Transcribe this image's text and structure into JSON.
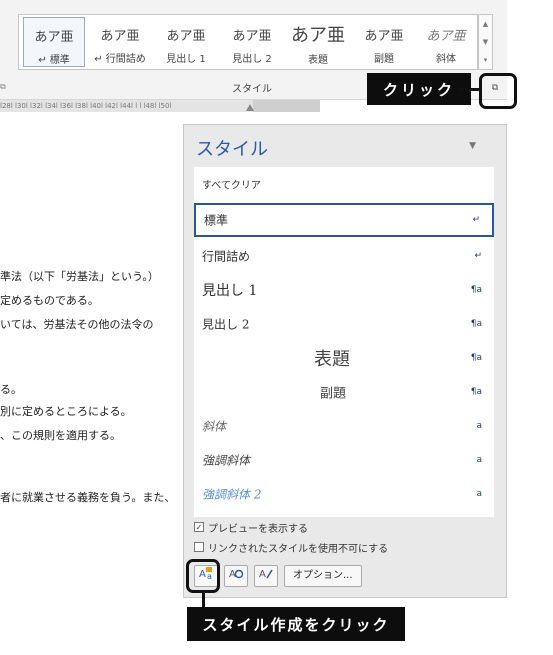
{
  "ribbon": {
    "gallery_items": [
      {
        "sample": "あア亜",
        "label": "↵ 標準"
      },
      {
        "sample": "あア亜",
        "label": "↵ 行間詰め"
      },
      {
        "sample": "あア亜",
        "label": "見出し 1"
      },
      {
        "sample": "あア亜",
        "label": "見出し 2"
      },
      {
        "sample": "あア亜",
        "label": "表題"
      },
      {
        "sample": "あア亜",
        "label": "副題"
      },
      {
        "sample": "あア亜",
        "label": "斜体"
      }
    ],
    "group_label": "スタイル",
    "launcher_icon": "dialog-launcher-icon"
  },
  "callouts": {
    "top": "クリック",
    "bottom": "スタイル作成をクリック"
  },
  "ruler": {
    "ticks": "l28l  l30l  l32l  l34l  l36l  l38l  l40l  l42l  l44l  l  l  l48l  l50l"
  },
  "document": {
    "lines": [
      "準法（以下「労基法」という。）",
      "定めるものである。",
      "いては、労基法その他の法令の",
      "る。",
      "別に定めるところによる。",
      "、この規則を適用する。",
      "者に就業させる義務を負う。また、"
    ]
  },
  "styles_pane": {
    "title": "スタイル",
    "dropdown_icon": "▼",
    "items": [
      {
        "name": "すべてクリア",
        "mark": ""
      },
      {
        "name": "標準",
        "mark": "↵"
      },
      {
        "name": "行間詰め",
        "mark": "↵"
      },
      {
        "name": "見出し 1",
        "mark": "¶a"
      },
      {
        "name": "見出し 2",
        "mark": "¶a"
      },
      {
        "name": "表題",
        "mark": "¶a"
      },
      {
        "name": "副題",
        "mark": "¶a"
      },
      {
        "name": "斜体",
        "mark": "a"
      },
      {
        "name": "強調斜体",
        "mark": "a"
      },
      {
        "name": "強調斜体 2",
        "mark": "a"
      }
    ],
    "options": [
      {
        "label": "プレビューを表示する",
        "checked": true
      },
      {
        "label": "リンクされたスタイルを使用不可にする",
        "checked": false
      }
    ],
    "buttons": {
      "new_style_icon": "new-style-icon",
      "style_inspector_icon": "style-inspector-icon",
      "manage_styles_icon": "manage-styles-icon",
      "options_label": "オプション..."
    }
  },
  "colors": {
    "accent_blue": "#2c59a8",
    "callout_bg": "#0d0d0d"
  }
}
